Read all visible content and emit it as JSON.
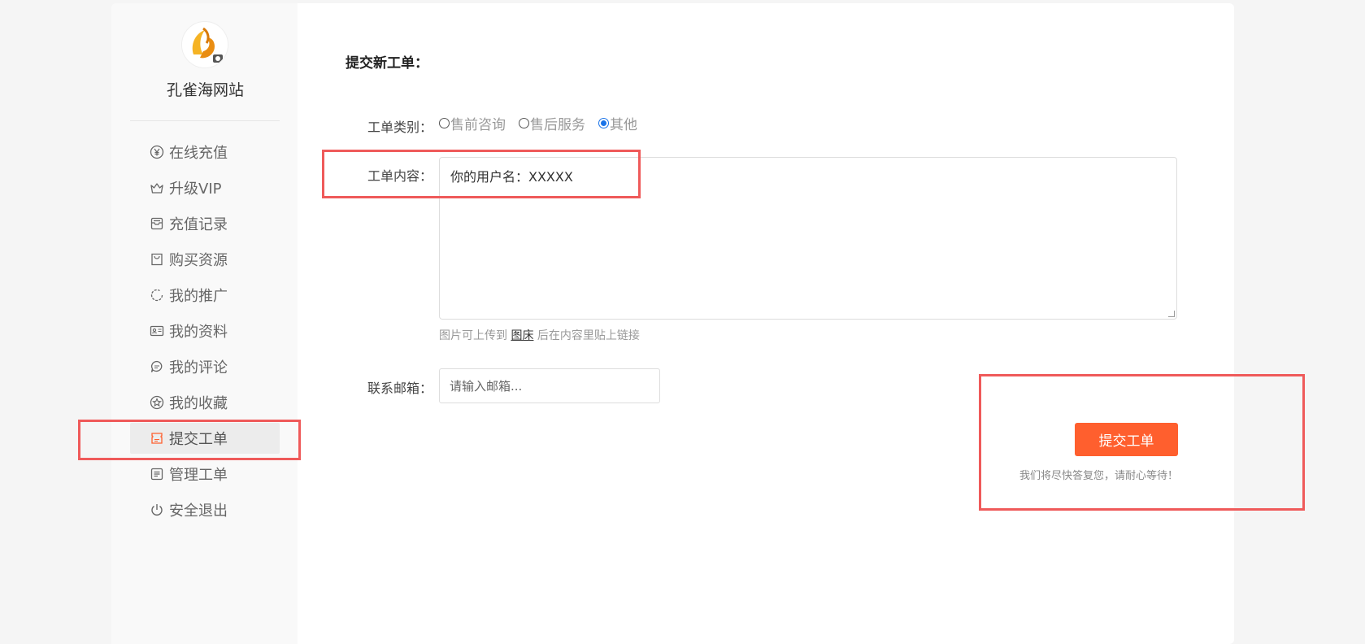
{
  "sidebar": {
    "site_name": "孔雀海网站",
    "items": [
      {
        "label": "在线充值",
        "icon": "yen-circle-icon"
      },
      {
        "label": "升级VIP",
        "icon": "crown-icon"
      },
      {
        "label": "充值记录",
        "icon": "inbox-icon"
      },
      {
        "label": "购买资源",
        "icon": "bag-icon"
      },
      {
        "label": "我的推广",
        "icon": "circle-refresh-icon"
      },
      {
        "label": "我的资料",
        "icon": "id-card-icon"
      },
      {
        "label": "我的评论",
        "icon": "chat-icon"
      },
      {
        "label": "我的收藏",
        "icon": "star-circle-icon"
      },
      {
        "label": "提交工单",
        "icon": "ticket-icon",
        "active": true
      },
      {
        "label": "管理工单",
        "icon": "list-icon"
      },
      {
        "label": "安全退出",
        "icon": "power-icon"
      }
    ]
  },
  "form": {
    "title": "提交新工单：",
    "category_label": "工单类别：",
    "categories": [
      {
        "label": "售前咨询",
        "selected": false
      },
      {
        "label": "售后服务",
        "selected": false
      },
      {
        "label": "其他",
        "selected": true
      }
    ],
    "content_label": "工单内容：",
    "content_value": "你的用户名：XXXXX",
    "hint_prefix": "图片可上传到 ",
    "hint_link": "图床",
    "hint_suffix": " 后在内容里贴上链接",
    "email_label": "联系邮箱：",
    "email_placeholder": "请输入邮箱...",
    "submit_label": "提交工单",
    "reply_note": "我们将尽快答复您，请耐心等待！"
  },
  "colors": {
    "accent": "#ff5f2e",
    "highlight": "#ef5a5a",
    "radio_selected": "#1a73e8"
  }
}
